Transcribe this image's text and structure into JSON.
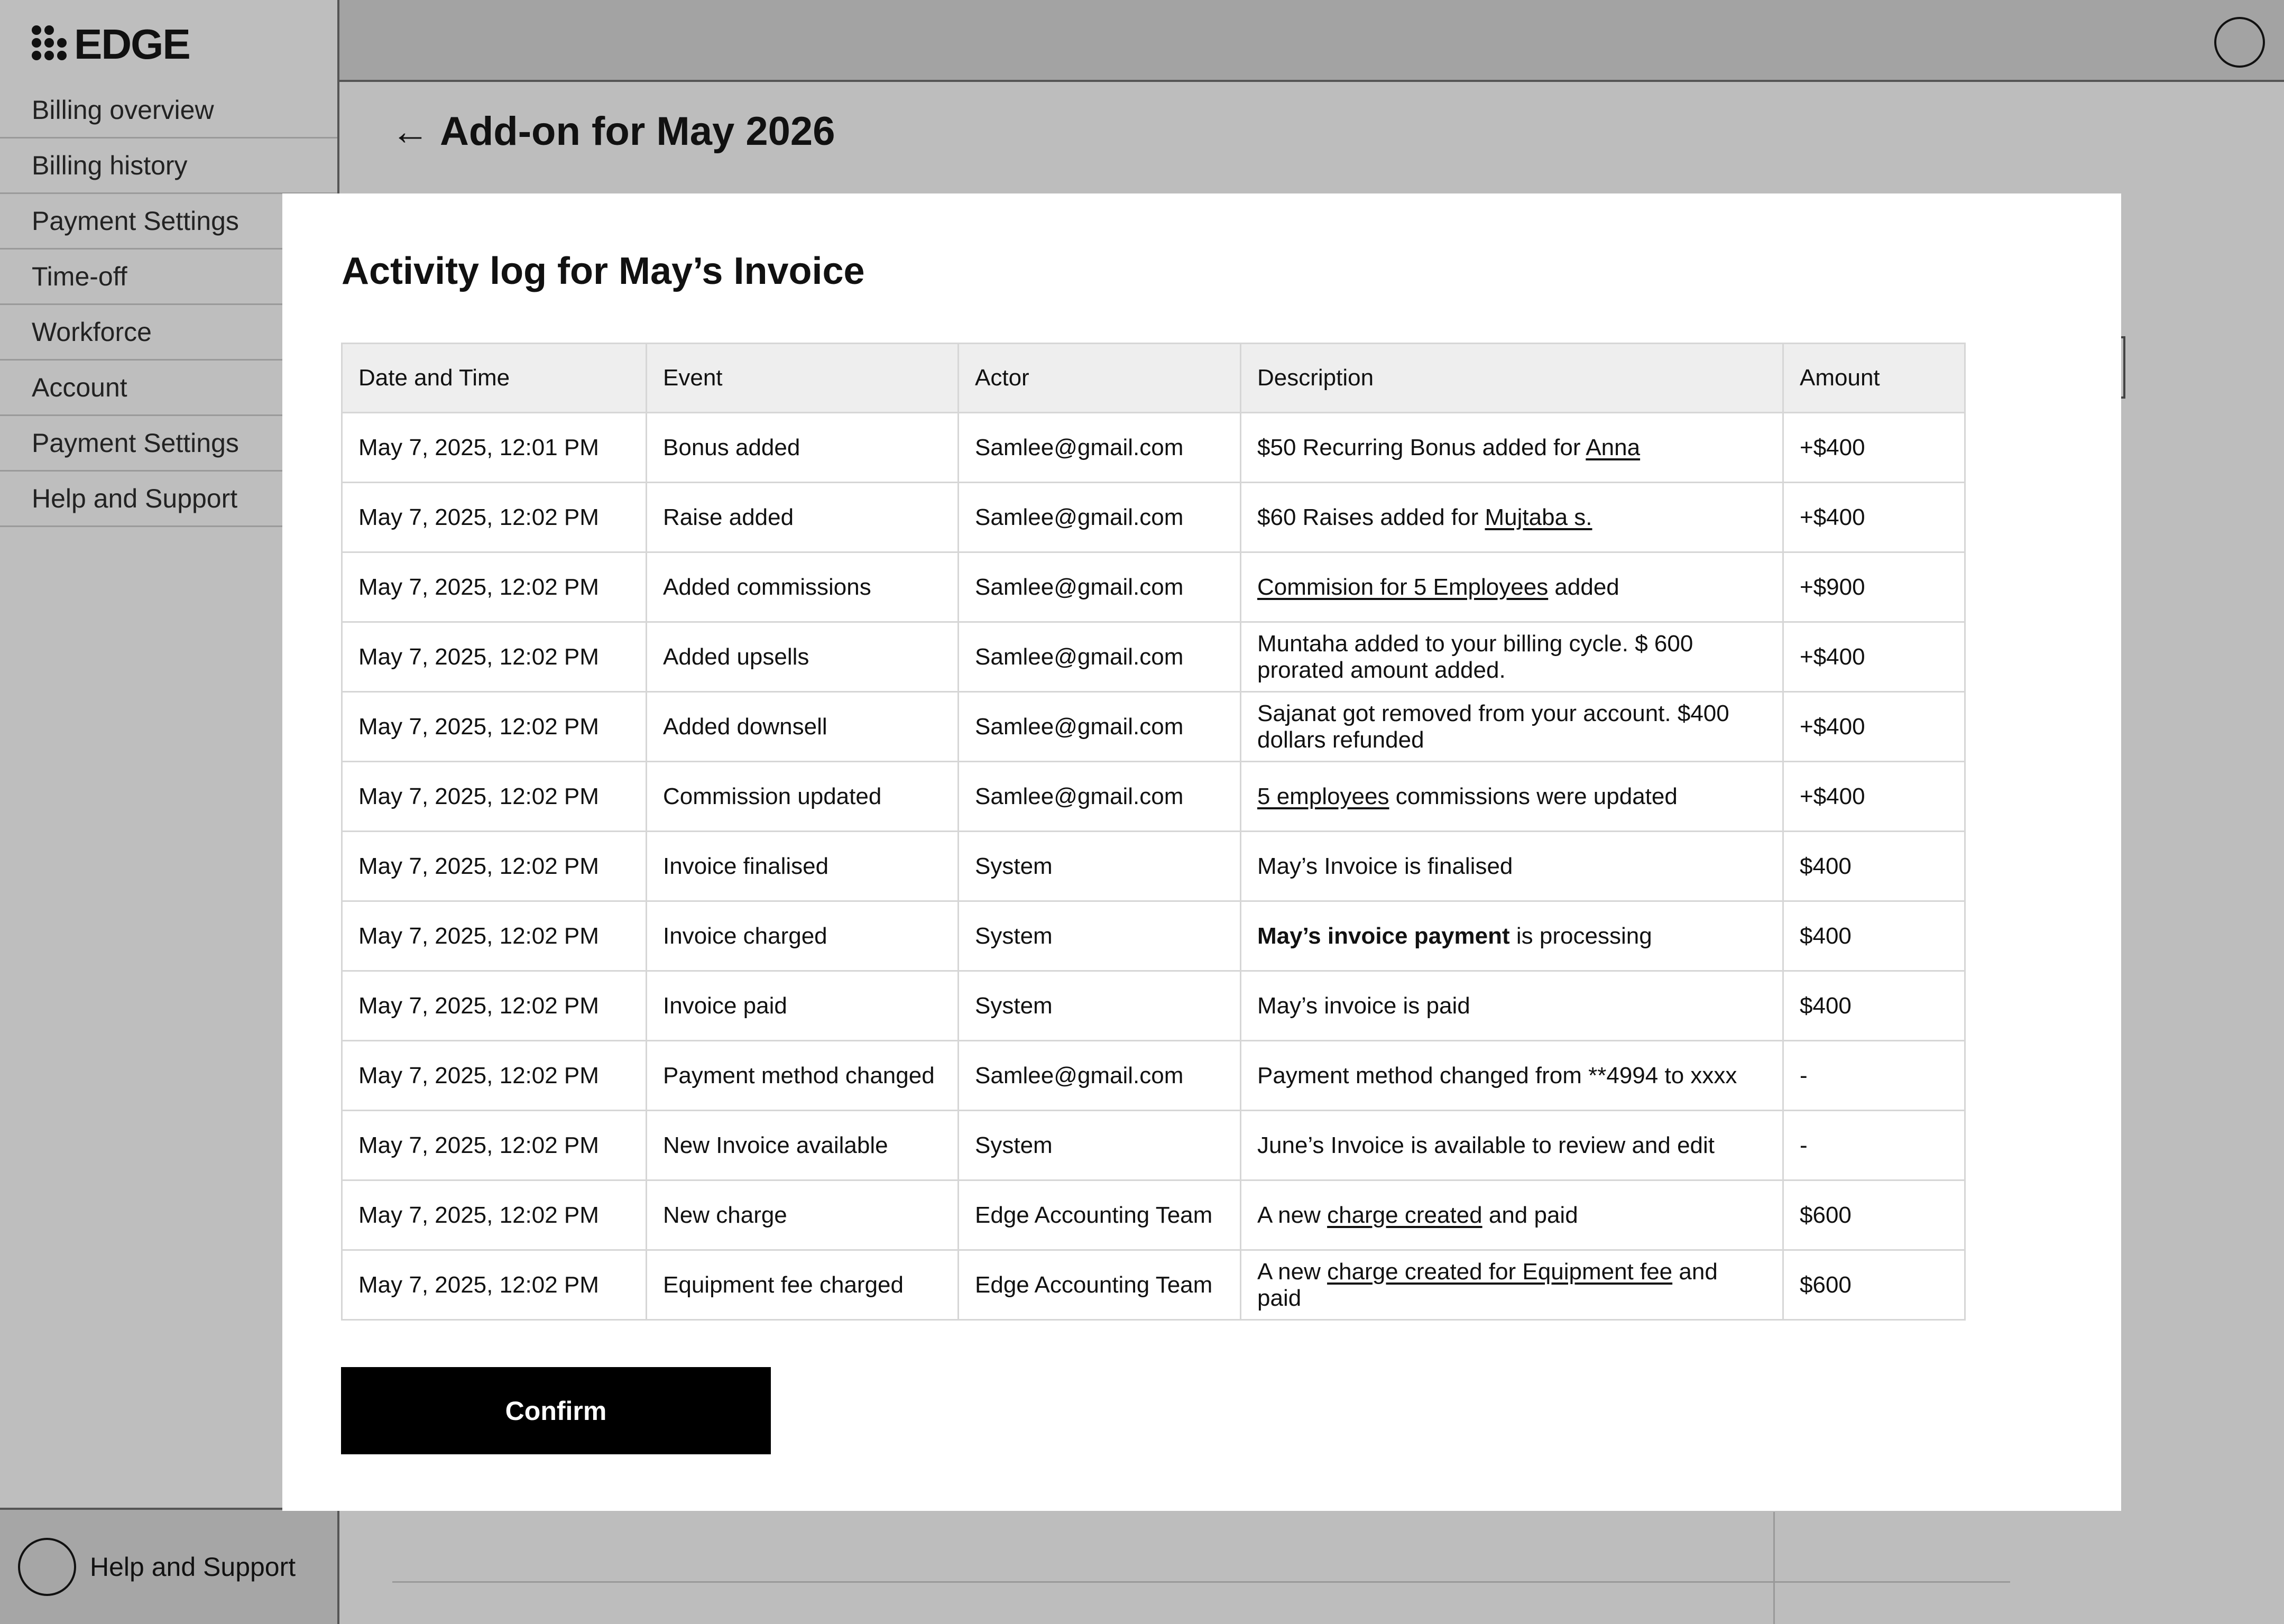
{
  "brand": {
    "name": "EDGE"
  },
  "sidebar": {
    "items": [
      {
        "label": "Billing overview"
      },
      {
        "label": "Billing history"
      },
      {
        "label": "Payment Settings"
      },
      {
        "label": "Time-off"
      },
      {
        "label": "Workforce"
      },
      {
        "label": "Account"
      },
      {
        "label": "Payment Settings"
      },
      {
        "label": "Help and Support"
      }
    ],
    "footer_label": "Help and Support"
  },
  "page": {
    "title": "Add-on for May 2026"
  },
  "modal": {
    "title": "Activity log for May’s Invoice",
    "columns": [
      "Date and Time",
      "Event",
      "Actor",
      "Description",
      "Amount"
    ],
    "rows": [
      {
        "date": "May 7, 2025, 12:01 PM",
        "event": "Bonus added",
        "actor": "Samlee@gmail.com",
        "desc_pre": "$50 Recurring Bonus added for ",
        "desc_link": "Anna",
        "desc_post": "",
        "amount": "+$400"
      },
      {
        "date": "May 7, 2025, 12:02 PM",
        "event": "Raise added",
        "actor": "Samlee@gmail.com",
        "desc_pre": "$60 Raises added for ",
        "desc_link": "Mujtaba s.",
        "desc_post": "",
        "amount": "+$400"
      },
      {
        "date": "May 7, 2025, 12:02 PM",
        "event": "Added commissions",
        "actor": "Samlee@gmail.com",
        "desc_pre": "",
        "desc_link": "Commision for 5 Employees",
        "desc_post": " added",
        "amount": "+$900"
      },
      {
        "date": "May 7, 2025, 12:02 PM",
        "event": "Added upsells",
        "actor": "Samlee@gmail.com",
        "desc_pre": "Muntaha added to your billing cycle. $ 600 prorated amount added.",
        "desc_link": "",
        "desc_post": "",
        "amount": "+$400"
      },
      {
        "date": "May 7, 2025, 12:02 PM",
        "event": "Added downsell",
        "actor": "Samlee@gmail.com",
        "desc_pre": "Sajanat got removed from your account. $400 dollars refunded",
        "desc_link": "",
        "desc_post": "",
        "amount": "+$400"
      },
      {
        "date": "May 7, 2025, 12:02 PM",
        "event": "Commission updated",
        "actor": "Samlee@gmail.com",
        "desc_pre": "",
        "desc_link": "5 employees",
        "desc_post": " commissions were updated",
        "amount": "+$400"
      },
      {
        "date": "May 7, 2025, 12:02 PM",
        "event": "Invoice finalised",
        "actor": "System",
        "desc_pre": "May’s Invoice is finalised",
        "desc_link": "",
        "desc_post": "",
        "amount": "$400"
      },
      {
        "date": "May 7, 2025, 12:02 PM",
        "event": "Invoice charged",
        "actor": "System",
        "desc_bold": "May’s invoice payment",
        "desc_pre": "",
        "desc_link": "",
        "desc_post": " is processing",
        "amount": "$400"
      },
      {
        "date": "May 7, 2025, 12:02 PM",
        "event": "Invoice paid",
        "actor": "System",
        "desc_pre": "May’s invoice is paid",
        "desc_link": "",
        "desc_post": "",
        "amount": "$400"
      },
      {
        "date": "May 7, 2025, 12:02 PM",
        "event": "Payment method changed",
        "actor": "Samlee@gmail.com",
        "desc_pre": "Payment method changed from **4994 to xxxx",
        "desc_link": "",
        "desc_post": "",
        "amount": "-"
      },
      {
        "date": "May 7, 2025, 12:02 PM",
        "event": "New Invoice available",
        "actor": "System",
        "desc_pre": "June’s Invoice is available to review and edit",
        "desc_link": "",
        "desc_post": "",
        "amount": "-"
      },
      {
        "date": "May 7, 2025, 12:02 PM",
        "event": "New charge",
        "actor": "Edge Accounting Team",
        "desc_pre": "A new ",
        "desc_link": "charge created",
        "desc_post": " and paid",
        "amount": "$600"
      },
      {
        "date": "May 7, 2025, 12:02 PM",
        "event": "Equipment fee charged",
        "actor": "Edge Accounting Team",
        "desc_pre": "A new ",
        "desc_link": "charge created for Equipment fee",
        "desc_post": " and paid",
        "amount": "$600"
      }
    ],
    "confirm_label": "Confirm"
  }
}
